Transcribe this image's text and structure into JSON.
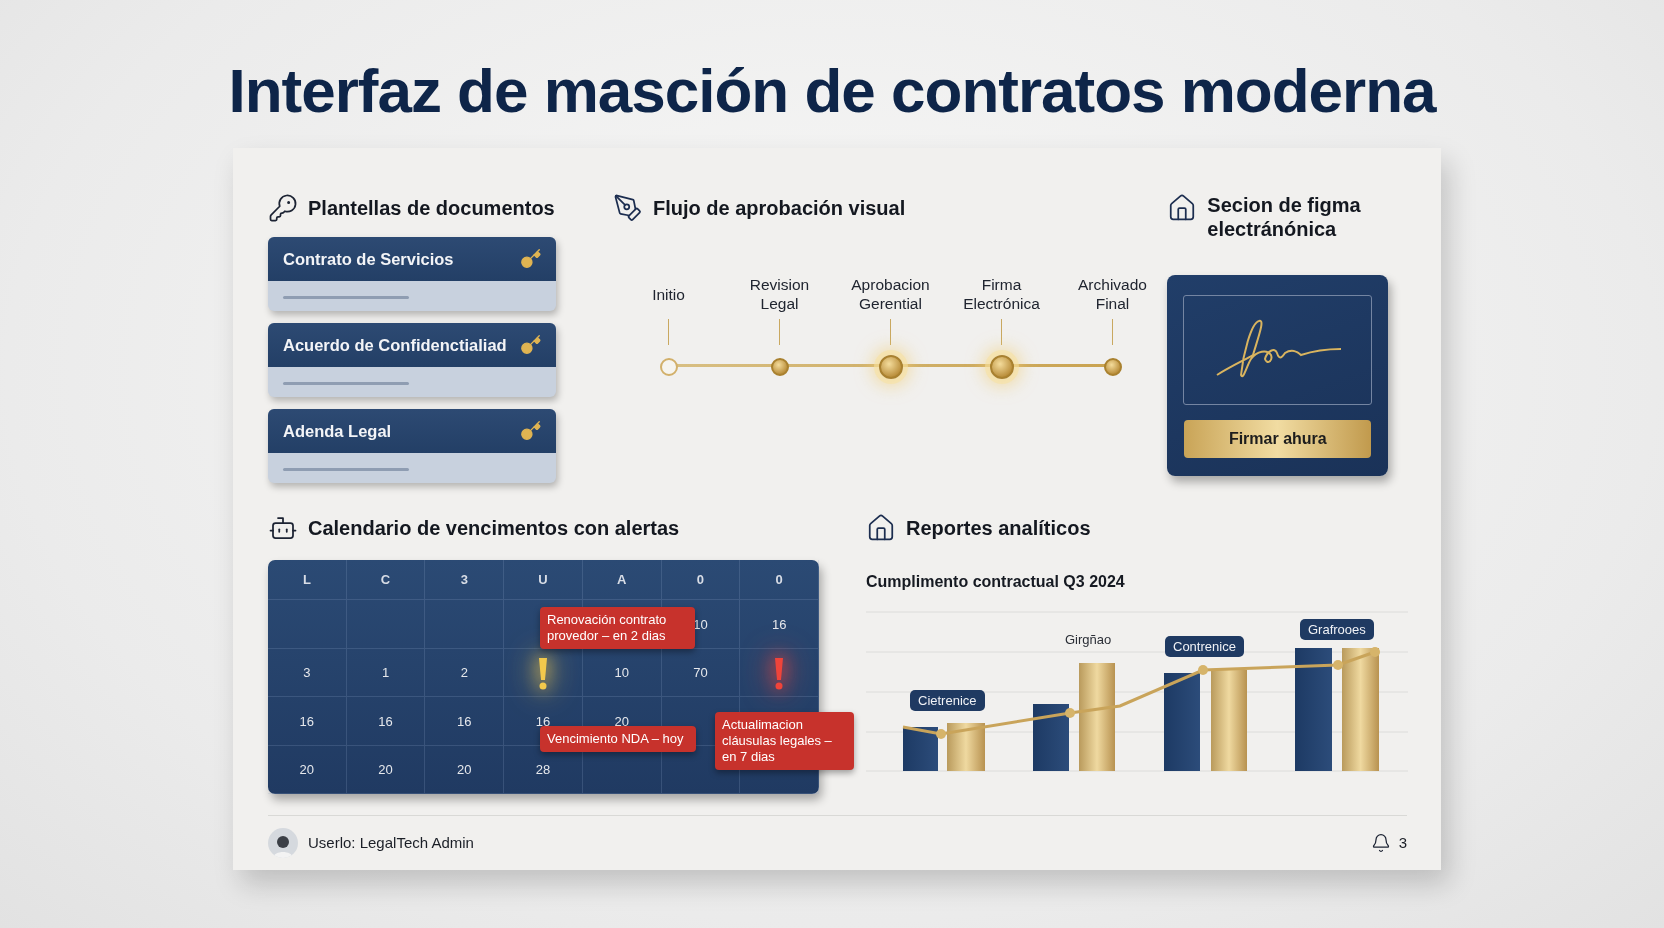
{
  "title": "Interfaz de masción de contratos moderna",
  "templates": {
    "heading": "Plantellas de documentos",
    "items": [
      {
        "name": "Contrato de Servicios"
      },
      {
        "name": "Acuerdo de Confidenctialiad"
      },
      {
        "name": "Adenda Legal"
      }
    ]
  },
  "approval_flow": {
    "heading": "Flujo de aprobación visual",
    "steps": [
      {
        "label": "Initio",
        "filled": false,
        "highlighted": false
      },
      {
        "label": "Revision Legal",
        "filled": true,
        "highlighted": false
      },
      {
        "label": "Aprobacion Gerential",
        "filled": true,
        "highlighted": true
      },
      {
        "label": "Firma Electrónica",
        "filled": true,
        "highlighted": true
      },
      {
        "label": "Archivado Final",
        "filled": true,
        "highlighted": false
      }
    ]
  },
  "signature": {
    "heading": "Secion de figma electránónica",
    "button": "Firmar ahura"
  },
  "calendar": {
    "heading": "Calendario de vencimentos con alertas",
    "weekdays": [
      "L",
      "C",
      "3",
      "U",
      "A",
      "0",
      "0"
    ],
    "weeks": [
      [
        {
          "kind": "blank"
        },
        {
          "kind": "blank"
        },
        {
          "kind": "blank"
        },
        {
          "kind": "blank"
        },
        {
          "kind": "blank"
        },
        {
          "kind": "day",
          "day": "10"
        },
        {
          "kind": "day",
          "day": "16"
        }
      ],
      [
        {
          "kind": "day",
          "day": "3"
        },
        {
          "kind": "day",
          "day": "1"
        },
        {
          "kind": "day",
          "day": "2"
        },
        {
          "kind": "alert",
          "color": "#f2c94c"
        },
        {
          "kind": "day",
          "day": "10"
        },
        {
          "kind": "day",
          "day": "70"
        },
        {
          "kind": "alert",
          "color": "#f0443a"
        }
      ],
      [
        {
          "kind": "day",
          "day": "16"
        },
        {
          "kind": "day",
          "day": "16"
        },
        {
          "kind": "day",
          "day": "16"
        },
        {
          "kind": "day",
          "day": "16"
        },
        {
          "kind": "day",
          "day": "20"
        },
        {
          "kind": "blank"
        },
        {
          "kind": "blank"
        }
      ],
      [
        {
          "kind": "day",
          "day": "20"
        },
        {
          "kind": "day",
          "day": "20"
        },
        {
          "kind": "day",
          "day": "20"
        },
        {
          "kind": "day",
          "day": "28"
        },
        {
          "kind": "blank"
        },
        {
          "kind": "blank"
        },
        {
          "kind": "blank"
        }
      ]
    ],
    "alerts": [
      {
        "text": "Renovación contrato provedor – en 2 dias"
      },
      {
        "text": "Vencimiento NDA – hoy"
      },
      {
        "text": "Actualimacion cláusulas legales – en 7 dias"
      }
    ]
  },
  "reports": {
    "heading": "Reportes analíticos",
    "chart_title": "Cumplimento contractual Q3 2024",
    "bar_labels": [
      {
        "text": "Cietrenice",
        "kind": "bubble"
      },
      {
        "text": "Girgñao",
        "kind": "plain"
      },
      {
        "text": "Contrenice",
        "kind": "bubble"
      },
      {
        "text": "Grafrooes",
        "kind": "bubble"
      }
    ]
  },
  "footer": {
    "user": "Userlo: LegalTech Admin",
    "notifications": "3"
  }
}
